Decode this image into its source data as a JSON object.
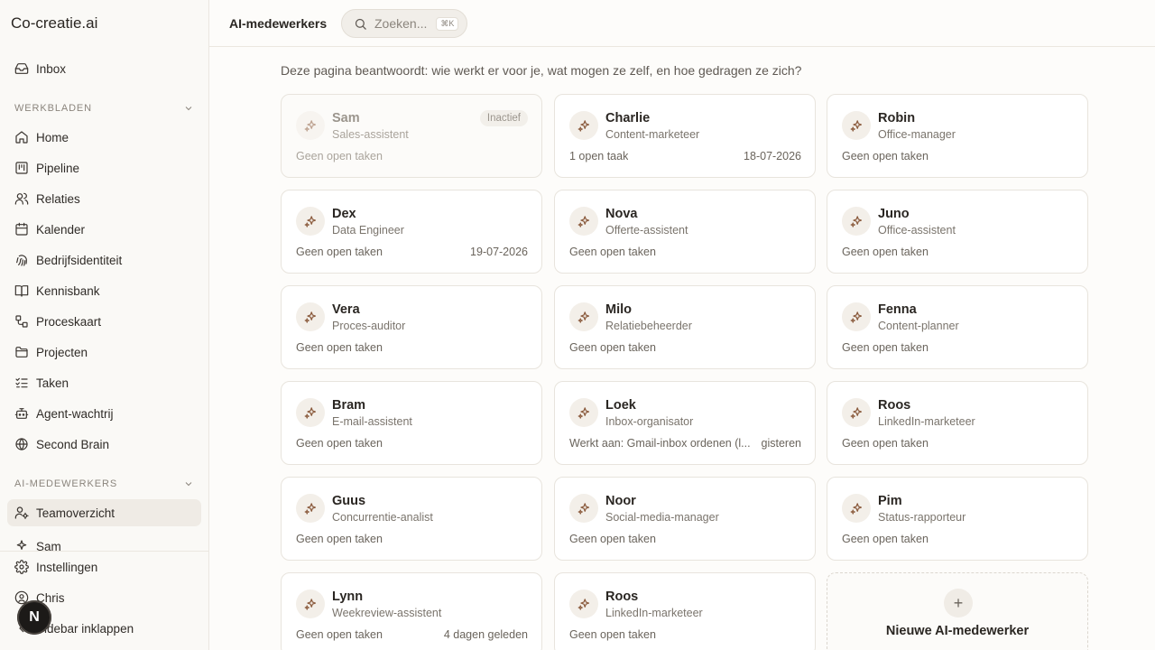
{
  "app": {
    "title": "Co-creatie.ai"
  },
  "sidebar": {
    "inbox": "Inbox",
    "section_werkbladen": "WERKBLADEN",
    "werkbladen": [
      {
        "label": "Home",
        "icon": "home-icon"
      },
      {
        "label": "Pipeline",
        "icon": "kanban-icon"
      },
      {
        "label": "Relaties",
        "icon": "users-icon"
      },
      {
        "label": "Kalender",
        "icon": "calendar-icon"
      },
      {
        "label": "Bedrijfsidentiteit",
        "icon": "fingerprint-icon"
      },
      {
        "label": "Kennisbank",
        "icon": "book-icon"
      },
      {
        "label": "Proceskaart",
        "icon": "workflow-icon"
      },
      {
        "label": "Projecten",
        "icon": "folder-icon"
      },
      {
        "label": "Taken",
        "icon": "list-checks-icon"
      },
      {
        "label": "Agent-wachtrij",
        "icon": "bot-icon"
      },
      {
        "label": "Second Brain",
        "icon": "brain-icon"
      }
    ],
    "section_ai": "AI-MEDEWERKERS",
    "ai_items": [
      {
        "label": "Teamoverzicht",
        "icon": "user-cog-icon",
        "active": true
      },
      {
        "label": "Sam",
        "icon": "sparkles-icon"
      }
    ],
    "settings": "Instellingen",
    "user": "Chris",
    "collapse": "Sidebar inklappen",
    "dev_badge": "N"
  },
  "header": {
    "title": "AI-medewerkers",
    "search_placeholder": "Zoeken...",
    "search_shortcut": "⌘K"
  },
  "main": {
    "intro": "Deze pagina beantwoordt: wie werkt er voor je, wat mogen ze zelf, en hoe gedragen ze zich?",
    "employees": [
      {
        "name": "Sam",
        "role": "Sales-assistent",
        "footer": "Geen open taken",
        "date": "",
        "badge": "Inactief",
        "inactive": true
      },
      {
        "name": "Charlie",
        "role": "Content-marketeer",
        "footer": "1 open taak",
        "date": "18-07-2026"
      },
      {
        "name": "Robin",
        "role": "Office-manager",
        "footer": "Geen open taken",
        "date": ""
      },
      {
        "name": "Dex",
        "role": "Data Engineer",
        "footer": "Geen open taken",
        "date": "19-07-2026"
      },
      {
        "name": "Nova",
        "role": "Offerte-assistent",
        "footer": "Geen open taken",
        "date": ""
      },
      {
        "name": "Juno",
        "role": "Office-assistent",
        "footer": "Geen open taken",
        "date": ""
      },
      {
        "name": "Vera",
        "role": "Proces-auditor",
        "footer": "Geen open taken",
        "date": ""
      },
      {
        "name": "Milo",
        "role": "Relatiebeheerder",
        "footer": "Geen open taken",
        "date": ""
      },
      {
        "name": "Fenna",
        "role": "Content-planner",
        "footer": "Geen open taken",
        "date": ""
      },
      {
        "name": "Bram",
        "role": "E-mail-assistent",
        "footer": "Geen open taken",
        "date": ""
      },
      {
        "name": "Loek",
        "role": "Inbox-organisator",
        "footer": "Werkt aan: Gmail-inbox ordenen (l...",
        "date": "gisteren"
      },
      {
        "name": "Roos",
        "role": "LinkedIn-marketeer",
        "footer": "Geen open taken",
        "date": ""
      },
      {
        "name": "Guus",
        "role": "Concurrentie-analist",
        "footer": "Geen open taken",
        "date": ""
      },
      {
        "name": "Noor",
        "role": "Social-media-manager",
        "footer": "Geen open taken",
        "date": ""
      },
      {
        "name": "Pim",
        "role": "Status-rapporteur",
        "footer": "Geen open taken",
        "date": ""
      },
      {
        "name": "Lynn",
        "role": "Weekreview-assistent",
        "footer": "Geen open taken",
        "date": "4 dagen geleden"
      },
      {
        "name": "Roos",
        "role": "LinkedIn-marketeer",
        "footer": "Geen open taken",
        "date": ""
      }
    ],
    "new_employee": "Nieuwe AI-medewerker"
  },
  "colors": {
    "accent": "#8a5a3c",
    "active_bg": "#efebe5",
    "border": "#e8e4dd"
  }
}
